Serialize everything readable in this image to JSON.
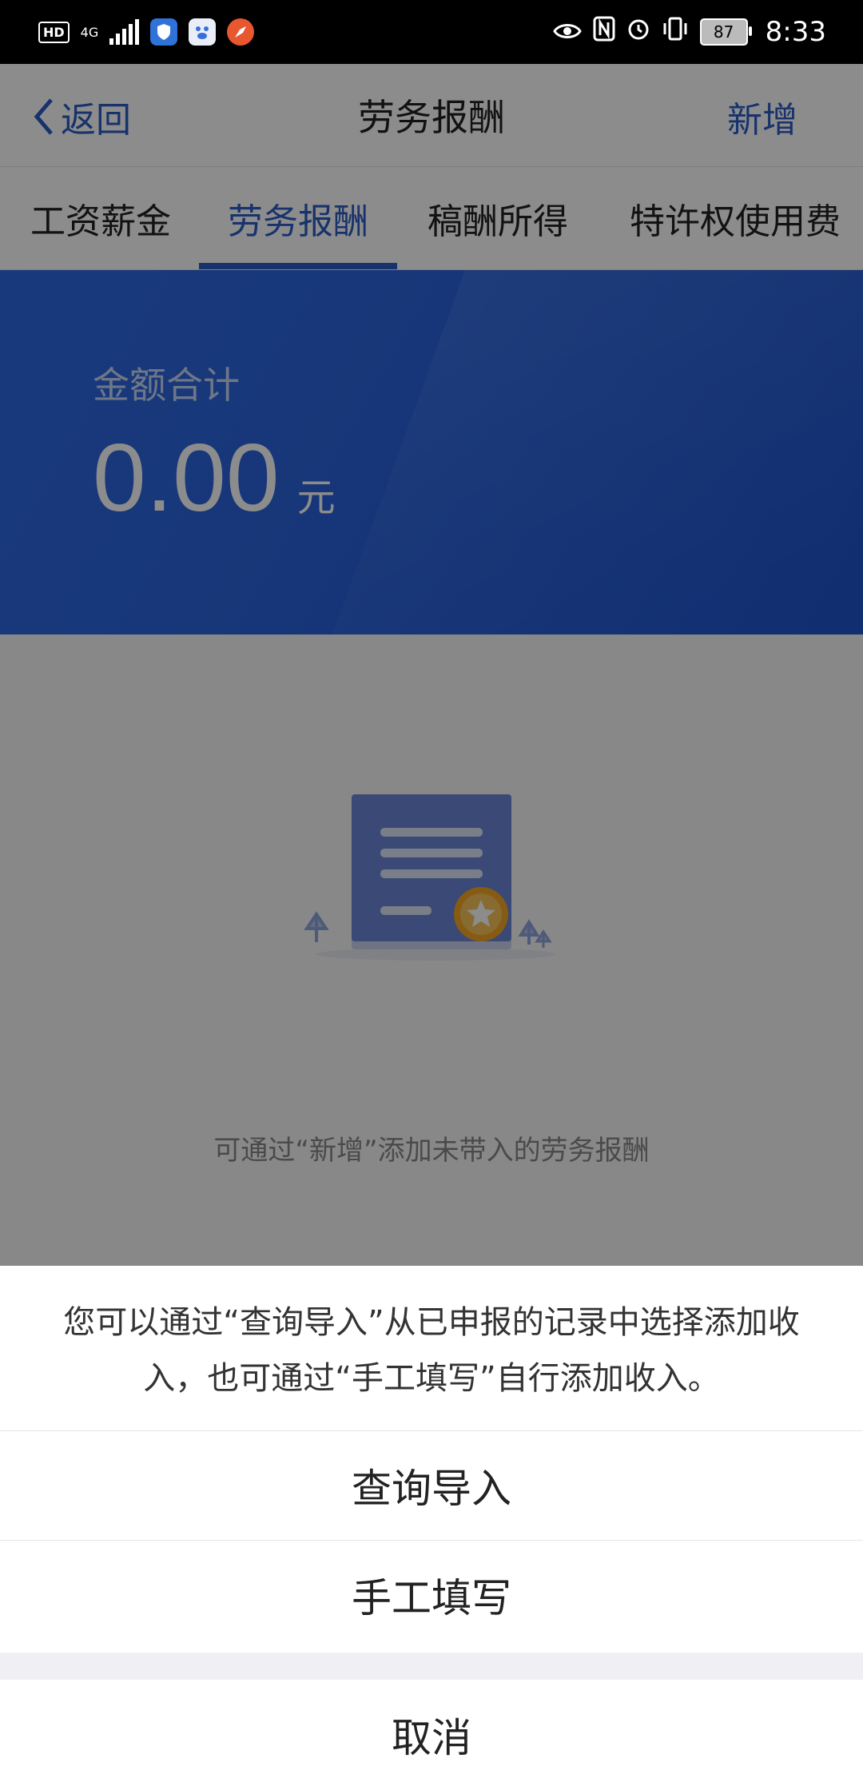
{
  "status_bar": {
    "left_icons": [
      "hd-icon",
      "signal-4g-icon",
      "shield-app-icon",
      "baidu-app-icon",
      "rocket-app-icon"
    ],
    "right_icons": [
      "eye-icon",
      "nfc-icon",
      "alarm-icon",
      "vibrate-icon"
    ],
    "hd": "HD",
    "network": "4G",
    "battery": "87",
    "time": "8:33"
  },
  "header": {
    "back_label": "返回",
    "title": "劳务报酬",
    "add_label": "新增"
  },
  "tabs": [
    {
      "label": "工资薪金",
      "active": false
    },
    {
      "label": "劳务报酬",
      "active": true
    },
    {
      "label": "稿酬所得",
      "active": false
    },
    {
      "label": "特许权使用费",
      "active": false
    }
  ],
  "banner": {
    "label": "金额合计",
    "amount": "0.00",
    "unit": "元"
  },
  "empty_state": {
    "icon": "document-star-icon",
    "text": "可通过“新增”添加未带入的劳务报酬"
  },
  "action_sheet": {
    "message": "您可以通过“查询导入”从已申报的记录中选择添加收入，也可通过“手工填写”自行添加收入。",
    "option_query": "查询导入",
    "option_manual": "手工填写",
    "cancel": "取消"
  },
  "colors": {
    "accent": "#2c5cc5",
    "banner": "#2a63dc",
    "overlay": "rgba(0,0,0,0.45)"
  }
}
